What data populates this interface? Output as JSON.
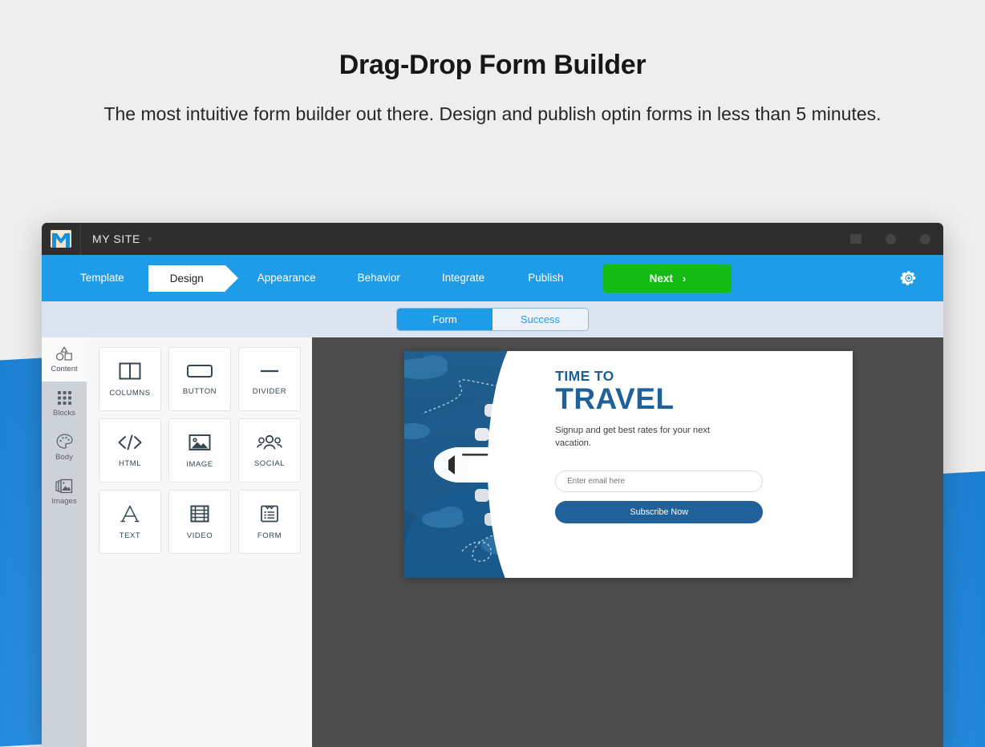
{
  "hero": {
    "title": "Drag-Drop Form Builder",
    "subtitle": "The most intuitive form builder out there. Design and publish optin forms in less than 5 minutes."
  },
  "app": {
    "titlebar": {
      "site_name": "MY SITE",
      "caret": "▾",
      "logo_icon": "mail-envelope-m-logo"
    },
    "steps_toolbar": {
      "steps": [
        {
          "label": "Template",
          "active": false
        },
        {
          "label": "Design",
          "active": true
        },
        {
          "label": "Appearance",
          "active": false
        },
        {
          "label": "Behavior",
          "active": false
        },
        {
          "label": "Integrate",
          "active": false
        },
        {
          "label": "Publish",
          "active": false
        }
      ],
      "next_label": "Next",
      "next_chevron": "›",
      "next_color": "#14bb14",
      "settings_icon": "gear-icon",
      "bar_color": "#1f9ce8"
    },
    "tabbar": {
      "tabs": [
        {
          "label": "Form",
          "active": true
        },
        {
          "label": "Success",
          "active": false
        }
      ],
      "accent": "#1f9ce8",
      "bar_color": "#dbe4ef"
    },
    "rail": {
      "items": [
        {
          "label": "Content",
          "icon": "shapes-icon",
          "active": true
        },
        {
          "label": "Blocks",
          "icon": "grid-icon",
          "active": false
        },
        {
          "label": "Body",
          "icon": "palette-icon",
          "active": false
        },
        {
          "label": "Images",
          "icon": "photos-icon",
          "active": false
        }
      ]
    },
    "blocks": [
      {
        "label": "COLUMNS",
        "icon": "columns-icon"
      },
      {
        "label": "BUTTON",
        "icon": "button-icon"
      },
      {
        "label": "DIVIDER",
        "icon": "divider-icon"
      },
      {
        "label": "HTML",
        "icon": "code-icon"
      },
      {
        "label": "IMAGE",
        "icon": "image-icon"
      },
      {
        "label": "SOCIAL",
        "icon": "social-icon"
      },
      {
        "label": "TEXT",
        "icon": "text-a-icon"
      },
      {
        "label": "VIDEO",
        "icon": "film-icon"
      },
      {
        "label": "FORM",
        "icon": "form-clipboard-icon"
      }
    ],
    "canvas": {
      "background": "#4d4d4d",
      "form_preview": {
        "illustration": "airplane-in-clouds-illustration",
        "heading_small": "TIME TO",
        "heading_large": "TRAVEL",
        "subtext": "Signup and get best rates for your next vacation.",
        "email_placeholder": "Enter email here",
        "email_value": "",
        "submit_label": "Subscribe Now",
        "brand_blue": "#1f6198"
      }
    }
  },
  "background": {
    "page_color": "#eeeeee",
    "accent_blue": "#2088d8"
  }
}
